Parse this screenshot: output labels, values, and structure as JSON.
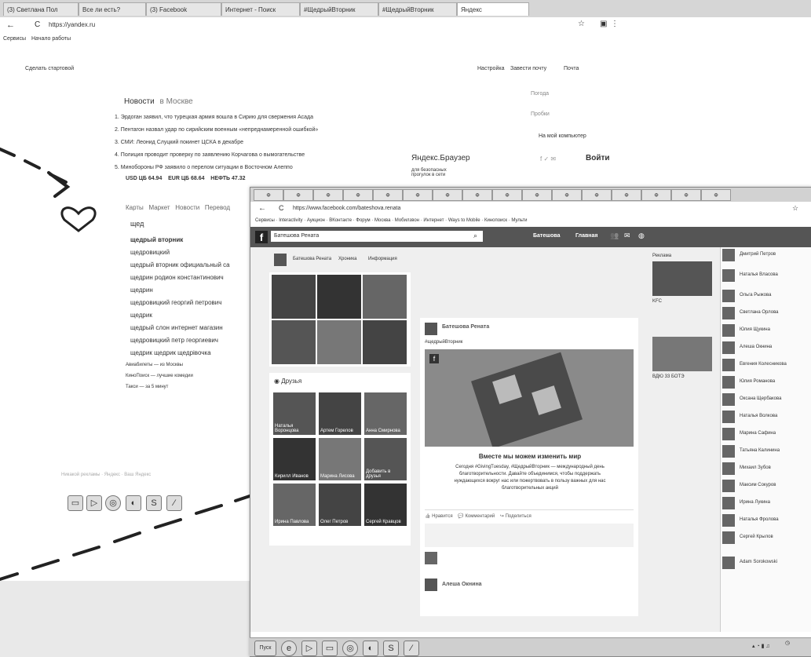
{
  "browser": {
    "tabs": [
      "(3) Светлана Пол",
      "Все ли есть?",
      "(3) Facebook",
      "Интернет - Поиск",
      "#ЩедрыйВторник",
      "#ЩедрыйВторник",
      "Яндекс"
    ],
    "address": "https://yandex.ru",
    "bookmarks": [
      "Сервисы",
      "Начало работы"
    ]
  },
  "yandex": {
    "make_start": "Сделать стартовой",
    "settings": "Настройка",
    "login": "Завести почту",
    "mail": "Почта",
    "news_title": "Новости",
    "news_region": "в Москве",
    "news": [
      "1. Эрдоган заявил, что турецкая армия вошла в Сирию для свержения Асада",
      "2. Пентагон назвал удар по сирийским военным «непреднамеренной ошибкой»",
      "3. СМИ: Леонид Слуцкий покинет ЦСКА в декабре",
      "4. Полиция проводит проверку по заявлению Корчагова о вымогательстве",
      "5. Минобороны РФ заявило о перелом ситуации в Восточном Алеппо"
    ],
    "rates": [
      {
        "name": "USD ЦБ",
        "value": "64.94"
      },
      {
        "name": "EUR ЦБ",
        "value": "68.64"
      },
      {
        "name": "НЕФТЬ",
        "value": "47.32"
      }
    ],
    "right_links": [
      "Погода",
      "Пробки",
      "На мой компьютер"
    ],
    "browser_promo_title": "Яндекс.Браузер",
    "browser_promo_text": "для безопасных прогулок в сети",
    "login_btn": "Войти",
    "nav": [
      "Карты",
      "Маркет",
      "Новости",
      "Перевод"
    ],
    "search_query": "щед",
    "suggestions": [
      "щедрый вторник",
      "щедровицкий",
      "щедрый вторник официальный са",
      "щедрин родион константинович",
      "щедрин",
      "щедровицкий георгий петрович",
      "щедрик",
      "щедрый слон интернет магазин",
      "щедровицкий петр георгиевич",
      "щедрик щедрик щедрівочка"
    ],
    "extra": [
      "Авиабилеты — из Москвы",
      "КиноПоиск — лучшие комедии",
      "Такси — за 5 минут"
    ],
    "footer_text": "Никакой рекламы · Яндекс · Ваш Яндекс"
  },
  "facebook": {
    "tabs": [
      "Ф",
      "Ф",
      "Ф",
      "Ф",
      "Ф",
      "Ф",
      "Ф",
      "Ф",
      "Ф",
      "Ф",
      "Ф",
      "Ф",
      "Ф",
      "Ф",
      "Ф",
      "Ф"
    ],
    "address": "https://www.facebook.com/bateshova.renata",
    "bookmarks": "Сервисы · Interactivity · Аукцион · ВКонтакте · Форум · Москва · Мобилзвон · Интернет · Ways to Mobile · Кинопоиск · Мульти",
    "search_value": "Батешова Рената",
    "profile_name": "Батешова",
    "main_btn": "Главная",
    "cover_name": "Батешова Рената",
    "cover_links": [
      "Хроника",
      "Информация"
    ],
    "friends_title": "Друзья",
    "friend_labels": [
      "Наталья Воронцова",
      "Артем Горелов",
      "Анна Смирнова",
      "Кирилл Иванов",
      "Марина Лисова",
      "Добавить в друзья",
      "Ирина Павлова",
      "Олег Петров",
      "Сергей Кравцов"
    ],
    "post_author": "Батешова Рената",
    "post_text": "#щедрыйВторник",
    "post_title": "Вместе мы можем изменить мир",
    "post_body": "Сегодня #GivingTuesday, #ЩедрыйВторник — международный день благотворительности. Давайте объединимся, чтобы поддержать нуждающихся вокруг нас или пожертвовать в пользу важных для нас благотворительных акций",
    "actions": [
      "Нравится",
      "Комментарий",
      "Поделиться"
    ],
    "comment_author": "Алеша Окнина",
    "ad_title": "Реклама",
    "ad1": "KFC",
    "ad2": "ВДЮ 33 БОТЭ",
    "chat": [
      "Дмитрий Петров",
      "Наталья Власова",
      "Ольга Рыжова",
      "Светлана Орлова",
      "Юлия Щукина",
      "Алеша Окнина",
      "Евгения Колесникова",
      "Юлия Романова",
      "Оксана Щербакова",
      "Наталья Волкова",
      "Марина Сафина",
      "Татьяна Калинина",
      "Михаил Зубов",
      "Максим Сокуров",
      "Ирина Лукина",
      "Наталья Фролова",
      "Сергей Крылов",
      "Adam Sorokowski"
    ]
  },
  "colors": {
    "fb_blue": "#3b5998",
    "accent": "#555555"
  }
}
